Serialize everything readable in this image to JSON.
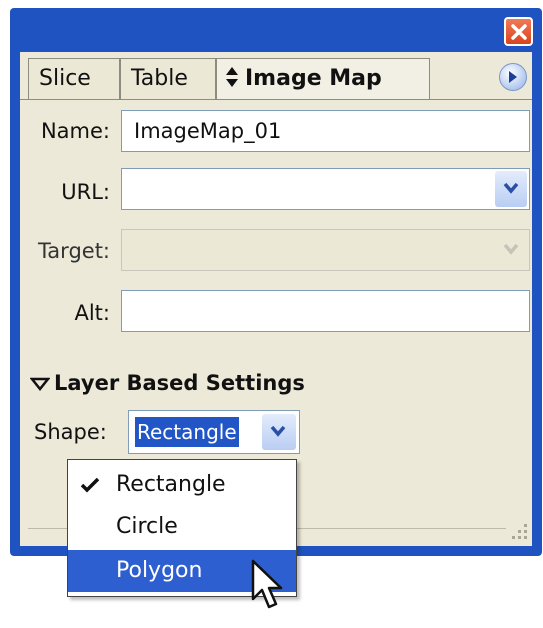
{
  "window": {
    "tabs": [
      {
        "label": "Slice",
        "active": false
      },
      {
        "label": "Table",
        "active": false
      },
      {
        "label": "Image Map",
        "active": true,
        "icon": "up-down-arrows-icon"
      }
    ]
  },
  "form": {
    "name": {
      "label": "Name:",
      "value": "ImageMap_01"
    },
    "url": {
      "label": "URL:",
      "value": ""
    },
    "target": {
      "label": "Target:",
      "value": "",
      "disabled": true
    },
    "alt": {
      "label": "Alt:",
      "value": ""
    }
  },
  "layer_settings": {
    "title": "Layer Based Settings",
    "shape_label": "Shape:",
    "shape_value": "Rectangle"
  },
  "shape_dropdown": {
    "options": [
      {
        "label": "Rectangle",
        "checked": true,
        "highlighted": false
      },
      {
        "label": "Circle",
        "checked": false,
        "highlighted": false
      },
      {
        "label": "Polygon",
        "checked": false,
        "highlighted": true
      }
    ]
  },
  "colors": {
    "title_bar": "#1f53c2",
    "panel": "#ece9d8",
    "highlight": "#2d5fd0",
    "close_button": "#d9441d"
  }
}
